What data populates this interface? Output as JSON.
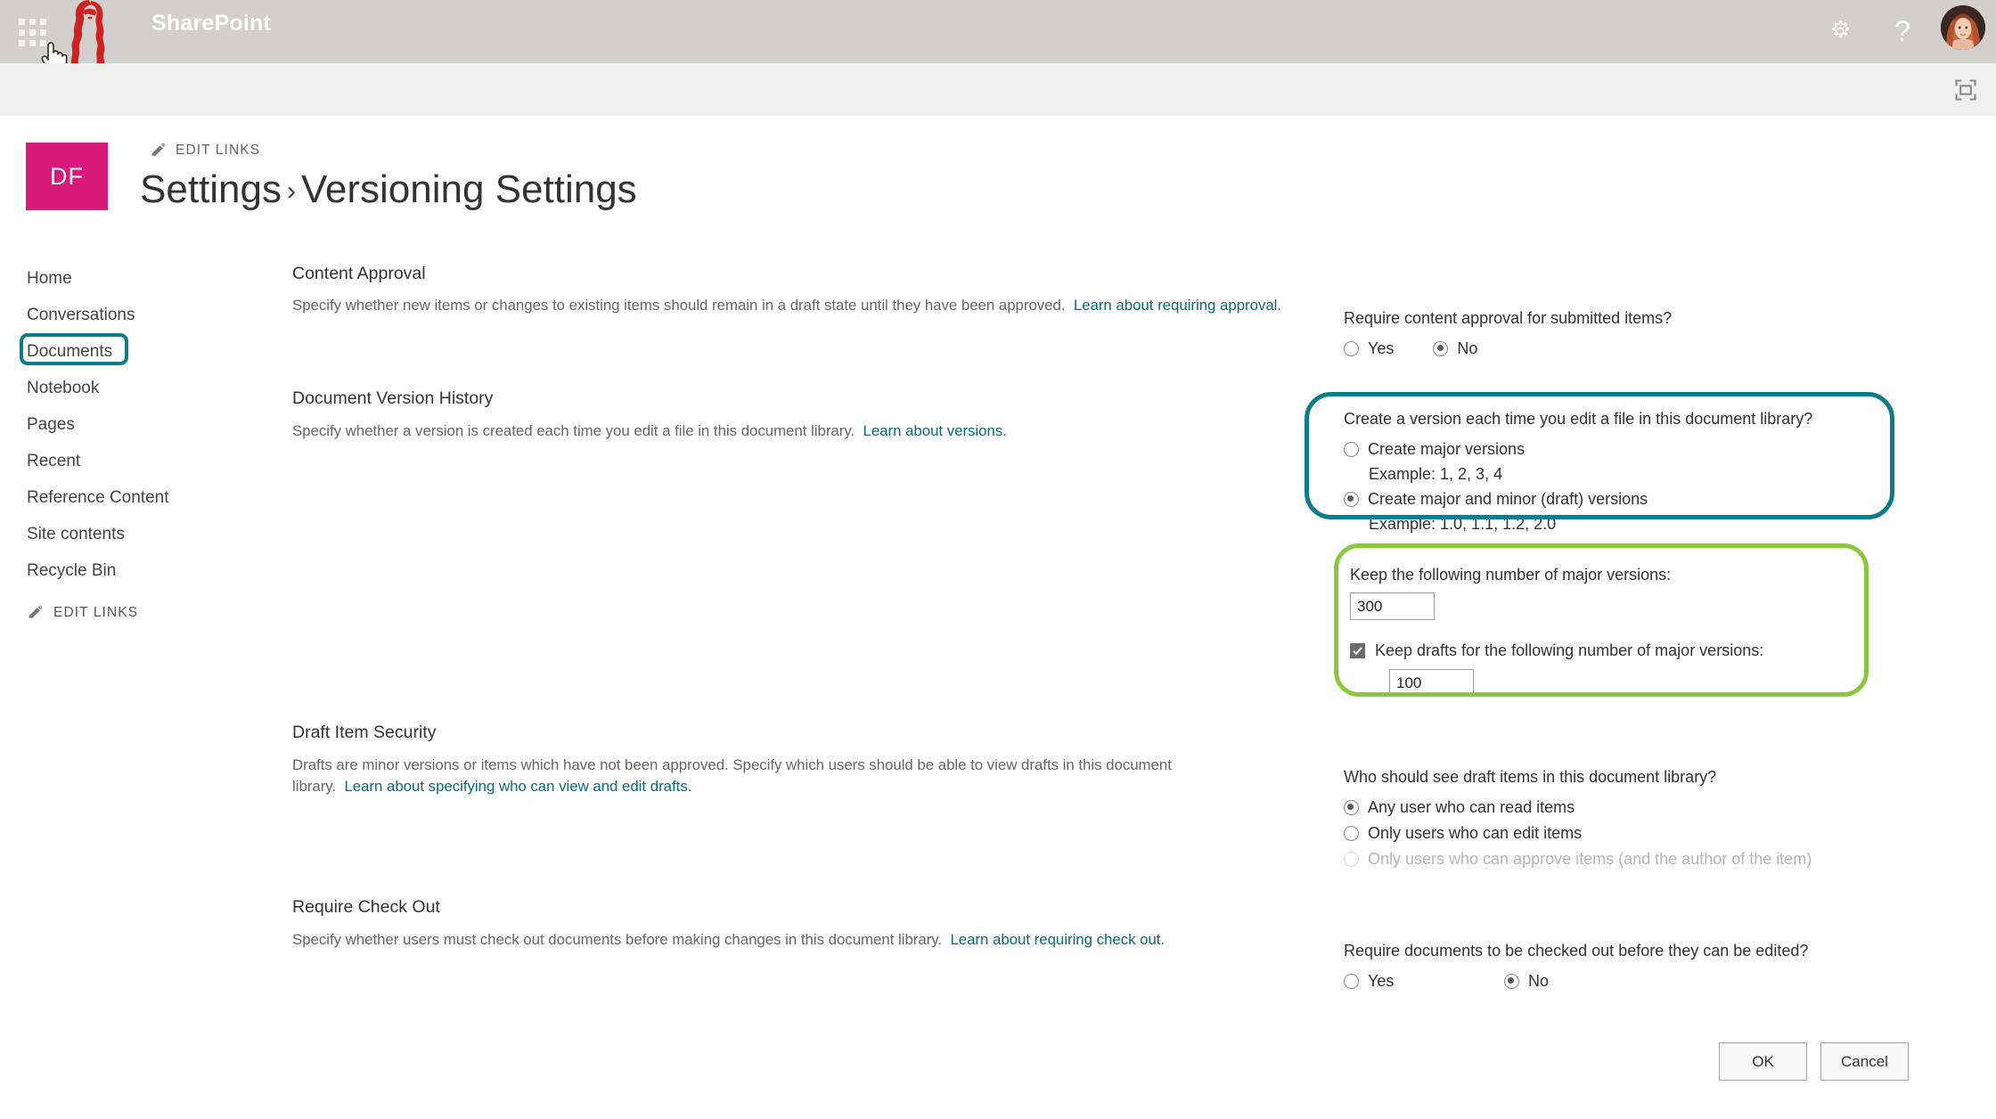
{
  "suite": {
    "title": "SharePoint",
    "waffle_label": "app-launcher",
    "gear_label": "Settings",
    "help_label": "?",
    "avatar_label": "User photo"
  },
  "site": {
    "logo_initials": "DF",
    "edit_links_top": "EDIT LINKS",
    "edit_links_bottom": "EDIT LINKS",
    "breadcrumb_parent": "Settings",
    "breadcrumb_separator": "›",
    "breadcrumb_current": "Versioning Settings"
  },
  "sidebar": {
    "items": [
      {
        "label": "Home",
        "selected": false
      },
      {
        "label": "Conversations",
        "selected": false
      },
      {
        "label": "Documents",
        "selected": true
      },
      {
        "label": "Notebook",
        "selected": false
      },
      {
        "label": "Pages",
        "selected": false
      },
      {
        "label": "Recent",
        "selected": false
      },
      {
        "label": "Reference Content",
        "selected": false
      },
      {
        "label": "Site contents",
        "selected": false
      },
      {
        "label": "Recycle Bin",
        "selected": false
      }
    ]
  },
  "sections": {
    "content_approval": {
      "title": "Content Approval",
      "desc": "Specify whether new items or changes to existing items should remain in a draft state until they have been approved.",
      "link": "Learn about requiring approval.",
      "question": "Require content approval for submitted items?",
      "options": [
        {
          "label": "Yes",
          "checked": false
        },
        {
          "label": "No",
          "checked": true
        }
      ]
    },
    "version_history": {
      "title": "Document Version History",
      "desc": "Specify whether a version is created each time you edit a file in this document library.",
      "link": "Learn about versions.",
      "question": "Create a version each time you edit a file in this document library?",
      "options": [
        {
          "label": "Create major versions",
          "example": "Example: 1, 2, 3, 4",
          "checked": false
        },
        {
          "label": "Create major and minor (draft) versions",
          "example": "Example: 1.0, 1.1, 1.2, 2.0",
          "checked": true
        }
      ],
      "major_versions_label": "Keep the following number of major versions:",
      "major_versions_value": "300",
      "keep_drafts_label": "Keep drafts for the following number of major versions:",
      "keep_drafts_checked": true,
      "keep_drafts_value": "100"
    },
    "draft_item_security": {
      "title": "Draft Item Security",
      "desc": "Drafts are minor versions or items which have not been approved. Specify which users should be able to view drafts in this document library.",
      "link": "Learn about specifying who can view and edit drafts.",
      "question": "Who should see draft items in this document library?",
      "options": [
        {
          "label": "Any user who can read items",
          "checked": true,
          "disabled": false
        },
        {
          "label": "Only users who can edit items",
          "checked": false,
          "disabled": false
        },
        {
          "label": "Only users who can approve items (and the author of the item)",
          "checked": false,
          "disabled": true
        }
      ]
    },
    "require_check_out": {
      "title": "Require Check Out",
      "desc": "Specify whether users must check out documents before making changes in this document library.",
      "link": "Learn about requiring check out.",
      "question": "Require documents to be checked out before they can be edited?",
      "options": [
        {
          "label": "Yes",
          "checked": false
        },
        {
          "label": "No",
          "checked": true
        }
      ]
    }
  },
  "footer": {
    "ok_label": "OK",
    "cancel_label": "Cancel"
  },
  "annotations": {
    "teal_color": "#0c7c89",
    "green_color": "#8cc63f",
    "site_logo_color": "#d81a7d",
    "suitebar_color": "#d2d0cd"
  }
}
